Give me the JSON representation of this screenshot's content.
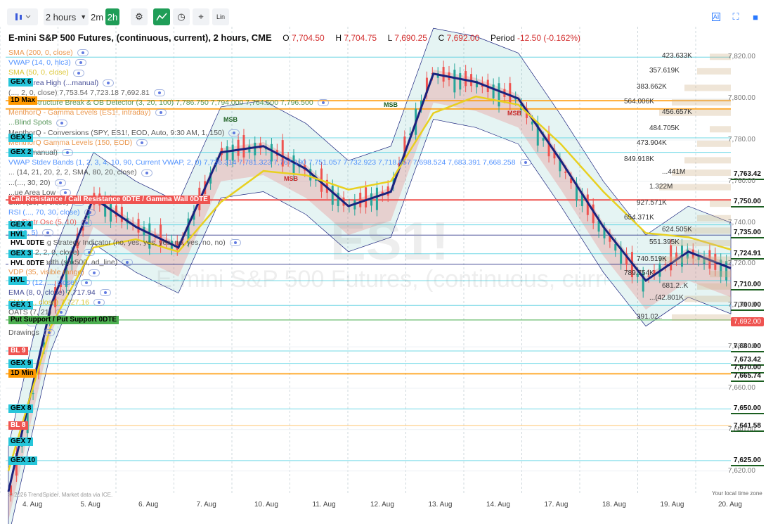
{
  "toolbar": {
    "interval": "2 hours",
    "quick_intervals": [
      "2m",
      "2h"
    ],
    "lin_label": "Lin"
  },
  "title": {
    "symbol_name": "E-mini S&P 500 Futures, (continuous, current), 2 hours, CME",
    "o_label": "O",
    "o_value": "7,704.50",
    "h_label": "H",
    "h_value": "7,704.75",
    "l_label": "L",
    "l_value": "7,690.25",
    "c_label": "C",
    "c_value": "7,692.00",
    "period_label": "Period",
    "period_change": "-12.50 (-0.162%)"
  },
  "watermark": {
    "ticker": "ES1!",
    "name": "E-mini S&P 500 Futures, (continuous, current)"
  },
  "legend": [
    {
      "text": "SMA (200, 0, close)",
      "color": "#e67e22"
    },
    {
      "text": "VWAP (14, 0, hlc3)",
      "color": "#2979ff"
    },
    {
      "text": "SMA (50, 0, close)",
      "color": "#d4b800"
    },
    {
      "text": "Value Area High (...manual)",
      "color": "#1a237e"
    },
    {
      "text": "(..., 2, 0, close) 7,753.54 7,723.18 7,692.81",
      "color": "#444"
    },
    {
      "text": "Market Structure Break & OB Detector (3, 20, 100) 7,786.750 7,794.000 7,764.500 7,796.500",
      "color": "#2e7d32"
    },
    {
      "text": "MenthorQ - Gamma Levels (ES1!, intraday)",
      "color": "#e67e22"
    },
    {
      "text": "...Blind Spots",
      "color": "#2e7d32"
    },
    {
      "text": "MenthorQ - Conversions (SPY, ES1!, EOD, Auto, 9:30 AM, 1, 150)",
      "color": "#333"
    },
    {
      "text": "MenthorQ Gamma Levels (150, EOD)",
      "color": "#e67e22"
    },
    {
      "text": "VP (... manual)",
      "color": "#333"
    },
    {
      "text": "VWAP Stdev Bands (1, 2, 3, 4, 10, 90, Current VWAP, 2, 0) 7,736.314 7,781.323 7,767.190 7,751.057 7,732.923 7,718.657 7,698.524 7,683.391 7,668.258",
      "color": "#2979ff"
    },
    {
      "text": "... (14, 21, 20, 2, 2, SMA, 80, 20, close)",
      "color": "#333"
    },
    {
      "text": "...(..., 30, 20)",
      "color": "#333"
    },
    {
      "text": "...ue Area Low",
      "color": "#333"
    },
    {
      "text": "SMA (20, 0, close)",
      "color": "#333"
    },
    {
      "text": "RSI (..., 70, 30, close)",
      "color": "#2979ff"
    },
    {
      "text": "Acc/Distr Osc (5, 10)",
      "color": "#e53935"
    },
    {
      "text": "... (20, 5)",
      "color": "#2979ff"
    },
    {
      "text": "ORB Trading Strategy Indicator (no, yes, yes, yes, no, yes, no, no)",
      "color": "#333"
    },
    {
      "text": "BB (20, 2, 2, 0, close)",
      "color": "#333"
    },
    {
      "text": "Market Breadth (spx500, ad_line)",
      "color": "#333"
    },
    {
      "text": "VDP (35, visible range)",
      "color": "#e67e22"
    },
    {
      "text": "MACD (12, ..., close)",
      "color": "#2979ff"
    },
    {
      "text": "EMA (8, 0, close) 7,717.94",
      "color": "#1a237e"
    },
    {
      "text": "EMA (..., close) 7,727.16",
      "color": "#d4b800"
    },
    {
      "text": "OATS (7, 21)",
      "color": "#333"
    },
    {
      "text": "Fibs",
      "color": "#333"
    },
    {
      "text": "Drawings",
      "color": "#333"
    }
  ],
  "level_tags": [
    {
      "label": "GEX 6",
      "price": 7808,
      "bg": "#26c6da"
    },
    {
      "label": "1D Max",
      "price": 7799,
      "bg": "#ff9800"
    },
    {
      "label": "GEX 5",
      "price": 7781,
      "bg": "#26c6da"
    },
    {
      "label": "GEX 2",
      "price": 7774,
      "bg": "#26c6da"
    },
    {
      "label": "Call Resistance / Call Resistance 0DTE / Gamma Wall 0DTE",
      "price": 7751,
      "bg": "#ef5350"
    },
    {
      "label": "GEX 4",
      "price": 7739,
      "bg": "#26c6da"
    },
    {
      "label": "HVL",
      "price": 7734,
      "bg": "#26c6da"
    },
    {
      "label": "HVL 0DTE",
      "price": 7730,
      "bg": "#ffffff"
    },
    {
      "label": "GEX 3",
      "price": 7725,
      "bg": "#26c6da"
    },
    {
      "label": "HVL 0DTE",
      "price": 7720,
      "bg": "#ffffff"
    },
    {
      "label": "HVL",
      "price": 7712,
      "bg": "#26c6da"
    },
    {
      "label": "GEX 1",
      "price": 7700,
      "bg": "#26c6da"
    },
    {
      "label": "Put Support / Put Support 0DTE",
      "price": 7693,
      "bg": "#4caf50"
    },
    {
      "label": "BL 9",
      "price": 7678,
      "bg": "#ef5350"
    },
    {
      "label": "GEX 9",
      "price": 7672,
      "bg": "#26c6da"
    },
    {
      "label": "1D Min",
      "price": 7667,
      "bg": "#ff9800"
    },
    {
      "label": "GEX 8",
      "price": 7650,
      "bg": "#26c6da"
    },
    {
      "label": "BL 8",
      "price": 7642,
      "bg": "#ef5350"
    },
    {
      "label": "GEX 7",
      "price": 7634,
      "bg": "#26c6da"
    },
    {
      "label": "GEX 10",
      "price": 7625,
      "bg": "#26c6da"
    }
  ],
  "chart_data": {
    "type": "line",
    "title": "E-mini S&P 500 Futures, (continuous, current), 2 hours, CME",
    "xlabel": "",
    "ylabel": "",
    "categories": [
      "4. Aug",
      "5. Aug",
      "6. Aug",
      "7. Aug",
      "10. Aug",
      "11. Aug",
      "12. Aug",
      "13. Aug",
      "14. Aug",
      "17. Aug",
      "18. Aug",
      "19. Aug",
      "20. Aug"
    ],
    "ylim": [
      7609,
      7832
    ],
    "y_ticks": [
      7820,
      7800,
      7780,
      7760,
      7740,
      7720,
      7700,
      7680,
      7660,
      7640,
      7620
    ],
    "grid": true,
    "series": [
      {
        "name": "EMA (8, 0, close)",
        "color": "#1a237e",
        "values": [
          7610,
          7700,
          7752,
          7738,
          7728,
          7774,
          7777,
          7766,
          7748,
          7755,
          7812,
          7808,
          7800,
          7770,
          7738,
          7712,
          7726,
          7718
        ]
      },
      {
        "name": "SMA (50, 0, close)",
        "color": "#e8d020",
        "values": [
          7620,
          7690,
          7728,
          7732,
          7726,
          7750,
          7765,
          7763,
          7756,
          7760,
          7793,
          7801,
          7797,
          7778,
          7755,
          7735,
          7733,
          7727
        ]
      }
    ],
    "price_markers": [
      {
        "price": "7,763.42",
        "value": 7763.42
      },
      {
        "price": "7,750.00",
        "value": 7750
      },
      {
        "price": "7,735.00",
        "value": 7735
      },
      {
        "price": "7,724.91",
        "value": 7724.91
      },
      {
        "price": "7,710.00",
        "value": 7710
      },
      {
        "price": "7,700.00",
        "value": 7700
      },
      {
        "price": "7,692.00",
        "value": 7692
      },
      {
        "price": "7,680.00",
        "value": 7680
      },
      {
        "price": "7,673.42",
        "value": 7673.42
      },
      {
        "price": "7,670.00",
        "value": 7670
      },
      {
        "price": "7,665.74",
        "value": 7665.74
      },
      {
        "price": "7,650.00",
        "value": 7650
      },
      {
        "price": "7,641.58",
        "value": 7641.58
      },
      {
        "price": "7,625.00",
        "value": 7625
      }
    ],
    "volume_profile_labels": [
      {
        "text": "423.633K",
        "value": 7820
      },
      {
        "text": "357.619K",
        "value": 7813
      },
      {
        "text": "383.662K",
        "value": 7805
      },
      {
        "text": "564.006K",
        "value": 7798
      },
      {
        "text": "456.657K",
        "value": 7793
      },
      {
        "text": "484.705K",
        "value": 7785
      },
      {
        "text": "473.904K",
        "value": 7778
      },
      {
        "text": "849.918K",
        "value": 7770
      },
      {
        "text": "...441M",
        "value": 7764
      },
      {
        "text": "1.322M",
        "value": 7757
      },
      {
        "text": "927.571K",
        "value": 7749
      },
      {
        "text": "654.371K",
        "value": 7742
      },
      {
        "text": "624.505K",
        "value": 7736
      },
      {
        "text": "551.395K",
        "value": 7730
      },
      {
        "text": "740.519K",
        "value": 7722
      },
      {
        "text": "789.754K",
        "value": 7715
      },
      {
        "text": "681.2..K",
        "value": 7709
      },
      {
        "text": "...(42.801K",
        "value": 7703
      },
      {
        "text": "391.02..",
        "value": 7694
      }
    ],
    "annotations": [
      "MSB",
      "MSB",
      "MSB",
      "MSB"
    ]
  },
  "footer": {
    "copyright": "© 2026 TrendSpider. Market data via ICE.",
    "timezone": "Your local time zone"
  }
}
